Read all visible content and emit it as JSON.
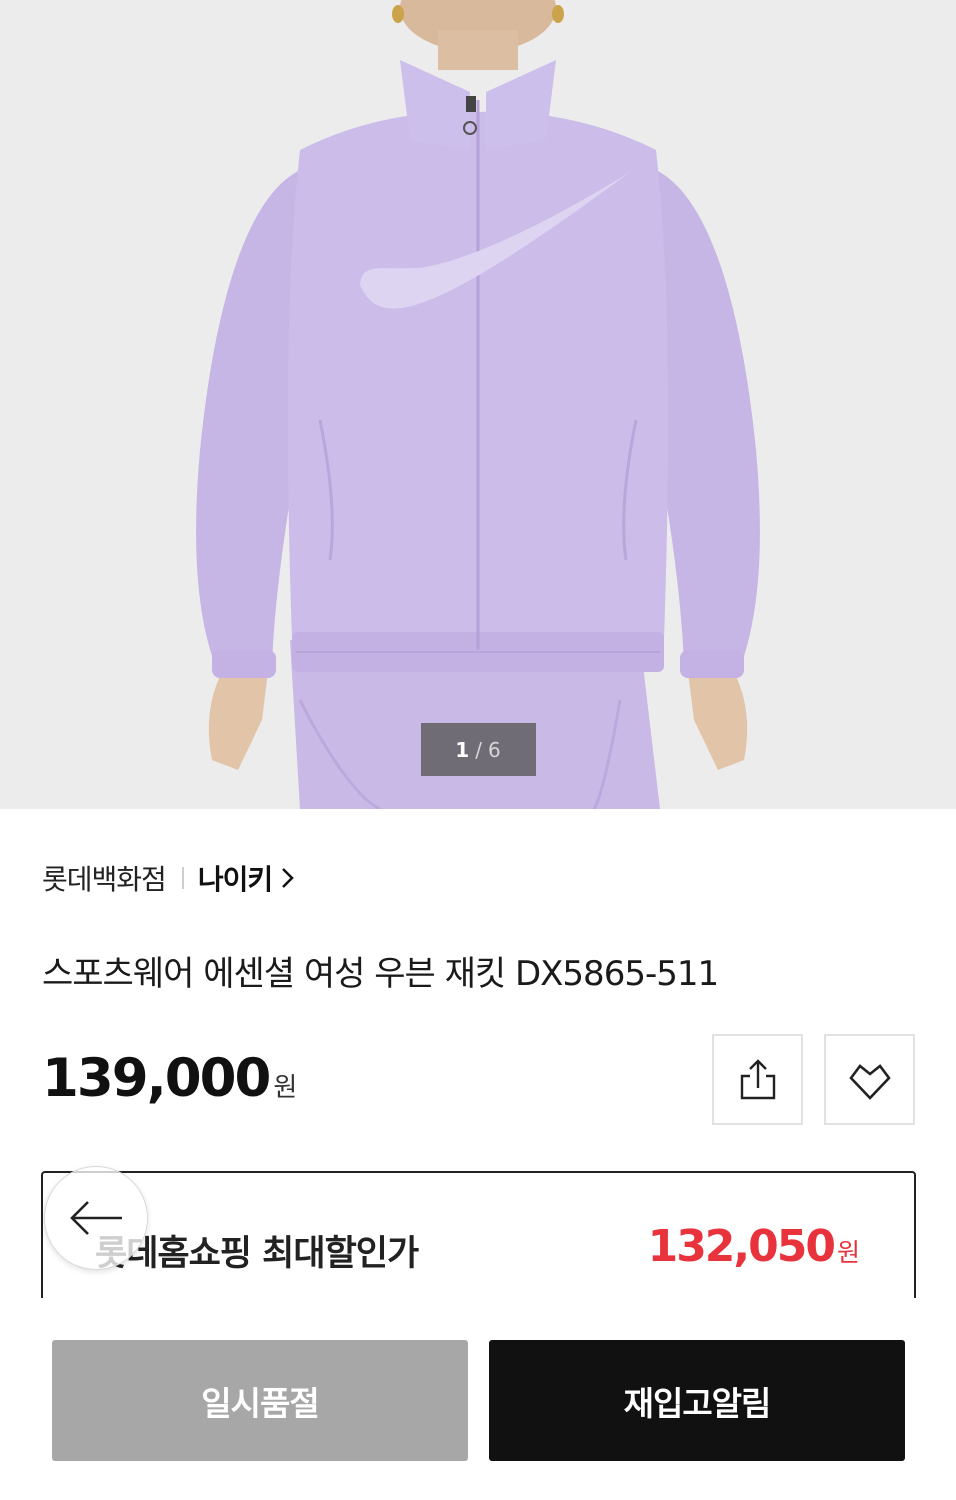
{
  "product_image": {
    "alt": "lavender nylon track jacket",
    "colors": {
      "background": "#ececec",
      "jacket": "#cbbce9",
      "swoosh": "#ddd4f2",
      "skin": "#e2c4a9"
    },
    "pager": {
      "current": "1",
      "separator": "/",
      "total": "6"
    }
  },
  "brand": {
    "store": "롯데백화점",
    "name": "나이키",
    "icon": "chevron-right-icon"
  },
  "product": {
    "title": "스포츠웨어 에센셜 여성 우븐 재킷 DX5865-511",
    "price": "139,000",
    "price_unit": "원"
  },
  "actions": {
    "share_icon": "share-icon",
    "wish_icon": "heart-icon"
  },
  "discount": {
    "label": "롯데홈쇼핑 최대할인가",
    "price": "132,050",
    "price_unit": "원",
    "color": "#e8323c"
  },
  "navigation": {
    "back_icon": "arrow-left-icon"
  },
  "bottom_bar": {
    "soldout_label": "일시품절",
    "restock_label": "재입고알림",
    "colors": {
      "soldout": "#a7a7a7",
      "restock": "#111111"
    }
  }
}
